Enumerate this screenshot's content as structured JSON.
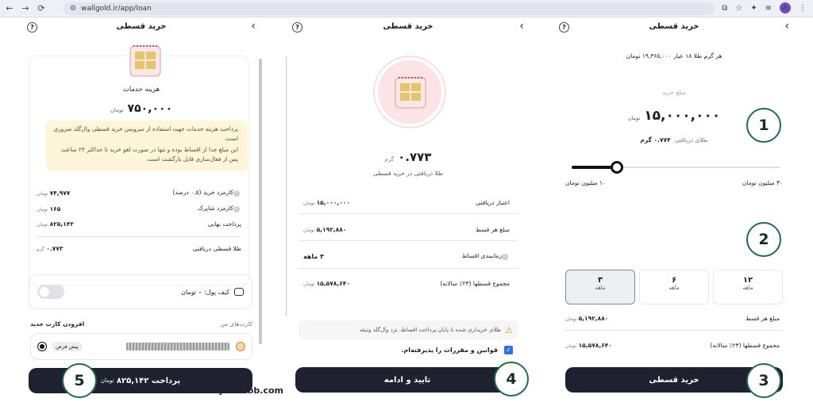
{
  "browser": {
    "url": "wallgold.ir/app/loan",
    "avatar": "A"
  },
  "header_title": "خرید قسطی",
  "icons": {
    "help": "?",
    "back": "‹"
  },
  "screen1": {
    "service_fee_label": "هزینه خدمات",
    "service_fee_value": "۷۵۰,۰۰۰",
    "toman": "تومان",
    "gram": "گرم",
    "notice1": "پرداخت هزینه خدمات جهت استفاده از سرویس خرید قسطی وال‌گلد ضروری است.",
    "notice2": "این مبلغ جدا از اقساط بوده و تنها در صورت لغو خرید تا حداکثر ۲۴ ساعت پس از فعال‌سازی قابل بازگشت است.",
    "rows": [
      {
        "label": "کارمزد خرید (۰.۵ درصد)",
        "value": "۷۴,۹۷۷",
        "unit": "تومان"
      },
      {
        "label": "کارمزد شاپرک",
        "value": "۱۶۵",
        "unit": "تومان"
      },
      {
        "label": "پرداخت نهایی",
        "value": "۸۲۵,۱۴۲",
        "unit": "تومان"
      }
    ],
    "gold_received_label": "طلا قسطی دریافتی",
    "gold_received_value": "۰.۷۷۳",
    "wallet_label": "کیف پول:",
    "wallet_value": "۰",
    "cards_label": "کارت‌های من",
    "add_card_label": "افزودن کارت جدید",
    "default_badge": "پیش فرض",
    "pay_button": "پرداخت ۸۲۵,۱۴۲",
    "pay_button_unit": "تومان",
    "step": "5"
  },
  "screen2": {
    "gold_amount": "۰.۷۷۳",
    "gold_unit": "گرم",
    "gold_caption": "طلا دریافتی در خرید قسطی",
    "rows": [
      {
        "label": "اعتبار دریافتی",
        "value": "۱۵,۰۰۰,۰۰۰",
        "unit": "تومان"
      },
      {
        "label": "مبلغ هر قسط",
        "value": "۵,۱۹۲,۸۸۰",
        "unit": "تومان"
      },
      {
        "label": "زمانبندی اقساط",
        "value": "۳ ماهه",
        "unit": ""
      },
      {
        "label": "مجموع قسطها (۲۳٪ سالانه)",
        "value": "۱۵,۵۷۸,۶۴۰",
        "unit": "تومان"
      }
    ],
    "warning": "طلای خریداری شده تا پایان پرداخت اقساط، نزد وال‌گلد وثیقه",
    "terms": "قوانین و مقررات را پذیرفته‌ام.",
    "confirm_button": "تایید و ادامه",
    "step": "4"
  },
  "screen3": {
    "price_per_gram": "هر گرم طلا ۱۸ عیار ۱۹,۳۶۵,۰۰۰ تومان",
    "purchase_amount_label": "مبلغ خرید",
    "purchase_amount": "۱۵,۰۰۰,۰۰۰",
    "toman": "تومان",
    "gold_received_label": "طلای دریافتی",
    "gold_received_value": "۰.۷۷۴ گرم",
    "slider_min": "۱۰ میلیون تومان",
    "slider_max": "۳۰ میلیون تومان",
    "slider_level": 0.1,
    "plans": [
      {
        "num": "۱۲",
        "unit": "ماهه",
        "selected": false
      },
      {
        "num": "۶",
        "unit": "ماهه",
        "selected": false
      },
      {
        "num": "۳",
        "unit": "ماهه",
        "selected": true
      }
    ],
    "installment_label": "مبلغ هر قسط",
    "installment_value": "۵,۱۹۲,۸۸۰",
    "total_label": "مجموع قسطها (۲۳٪ سالانه)",
    "total_value": "۱۵,۵۷۸,۶۴۰",
    "buy_button": "خرید قسطی",
    "steps": [
      "1",
      "2",
      "3"
    ]
  },
  "watermark": "Royalclubb.com",
  "colors": {
    "accent_dark": "#1e2230",
    "step_ring": "#1f6b4b",
    "notice_bg": "#fff6d9",
    "checkbox": "#2f6fde"
  }
}
